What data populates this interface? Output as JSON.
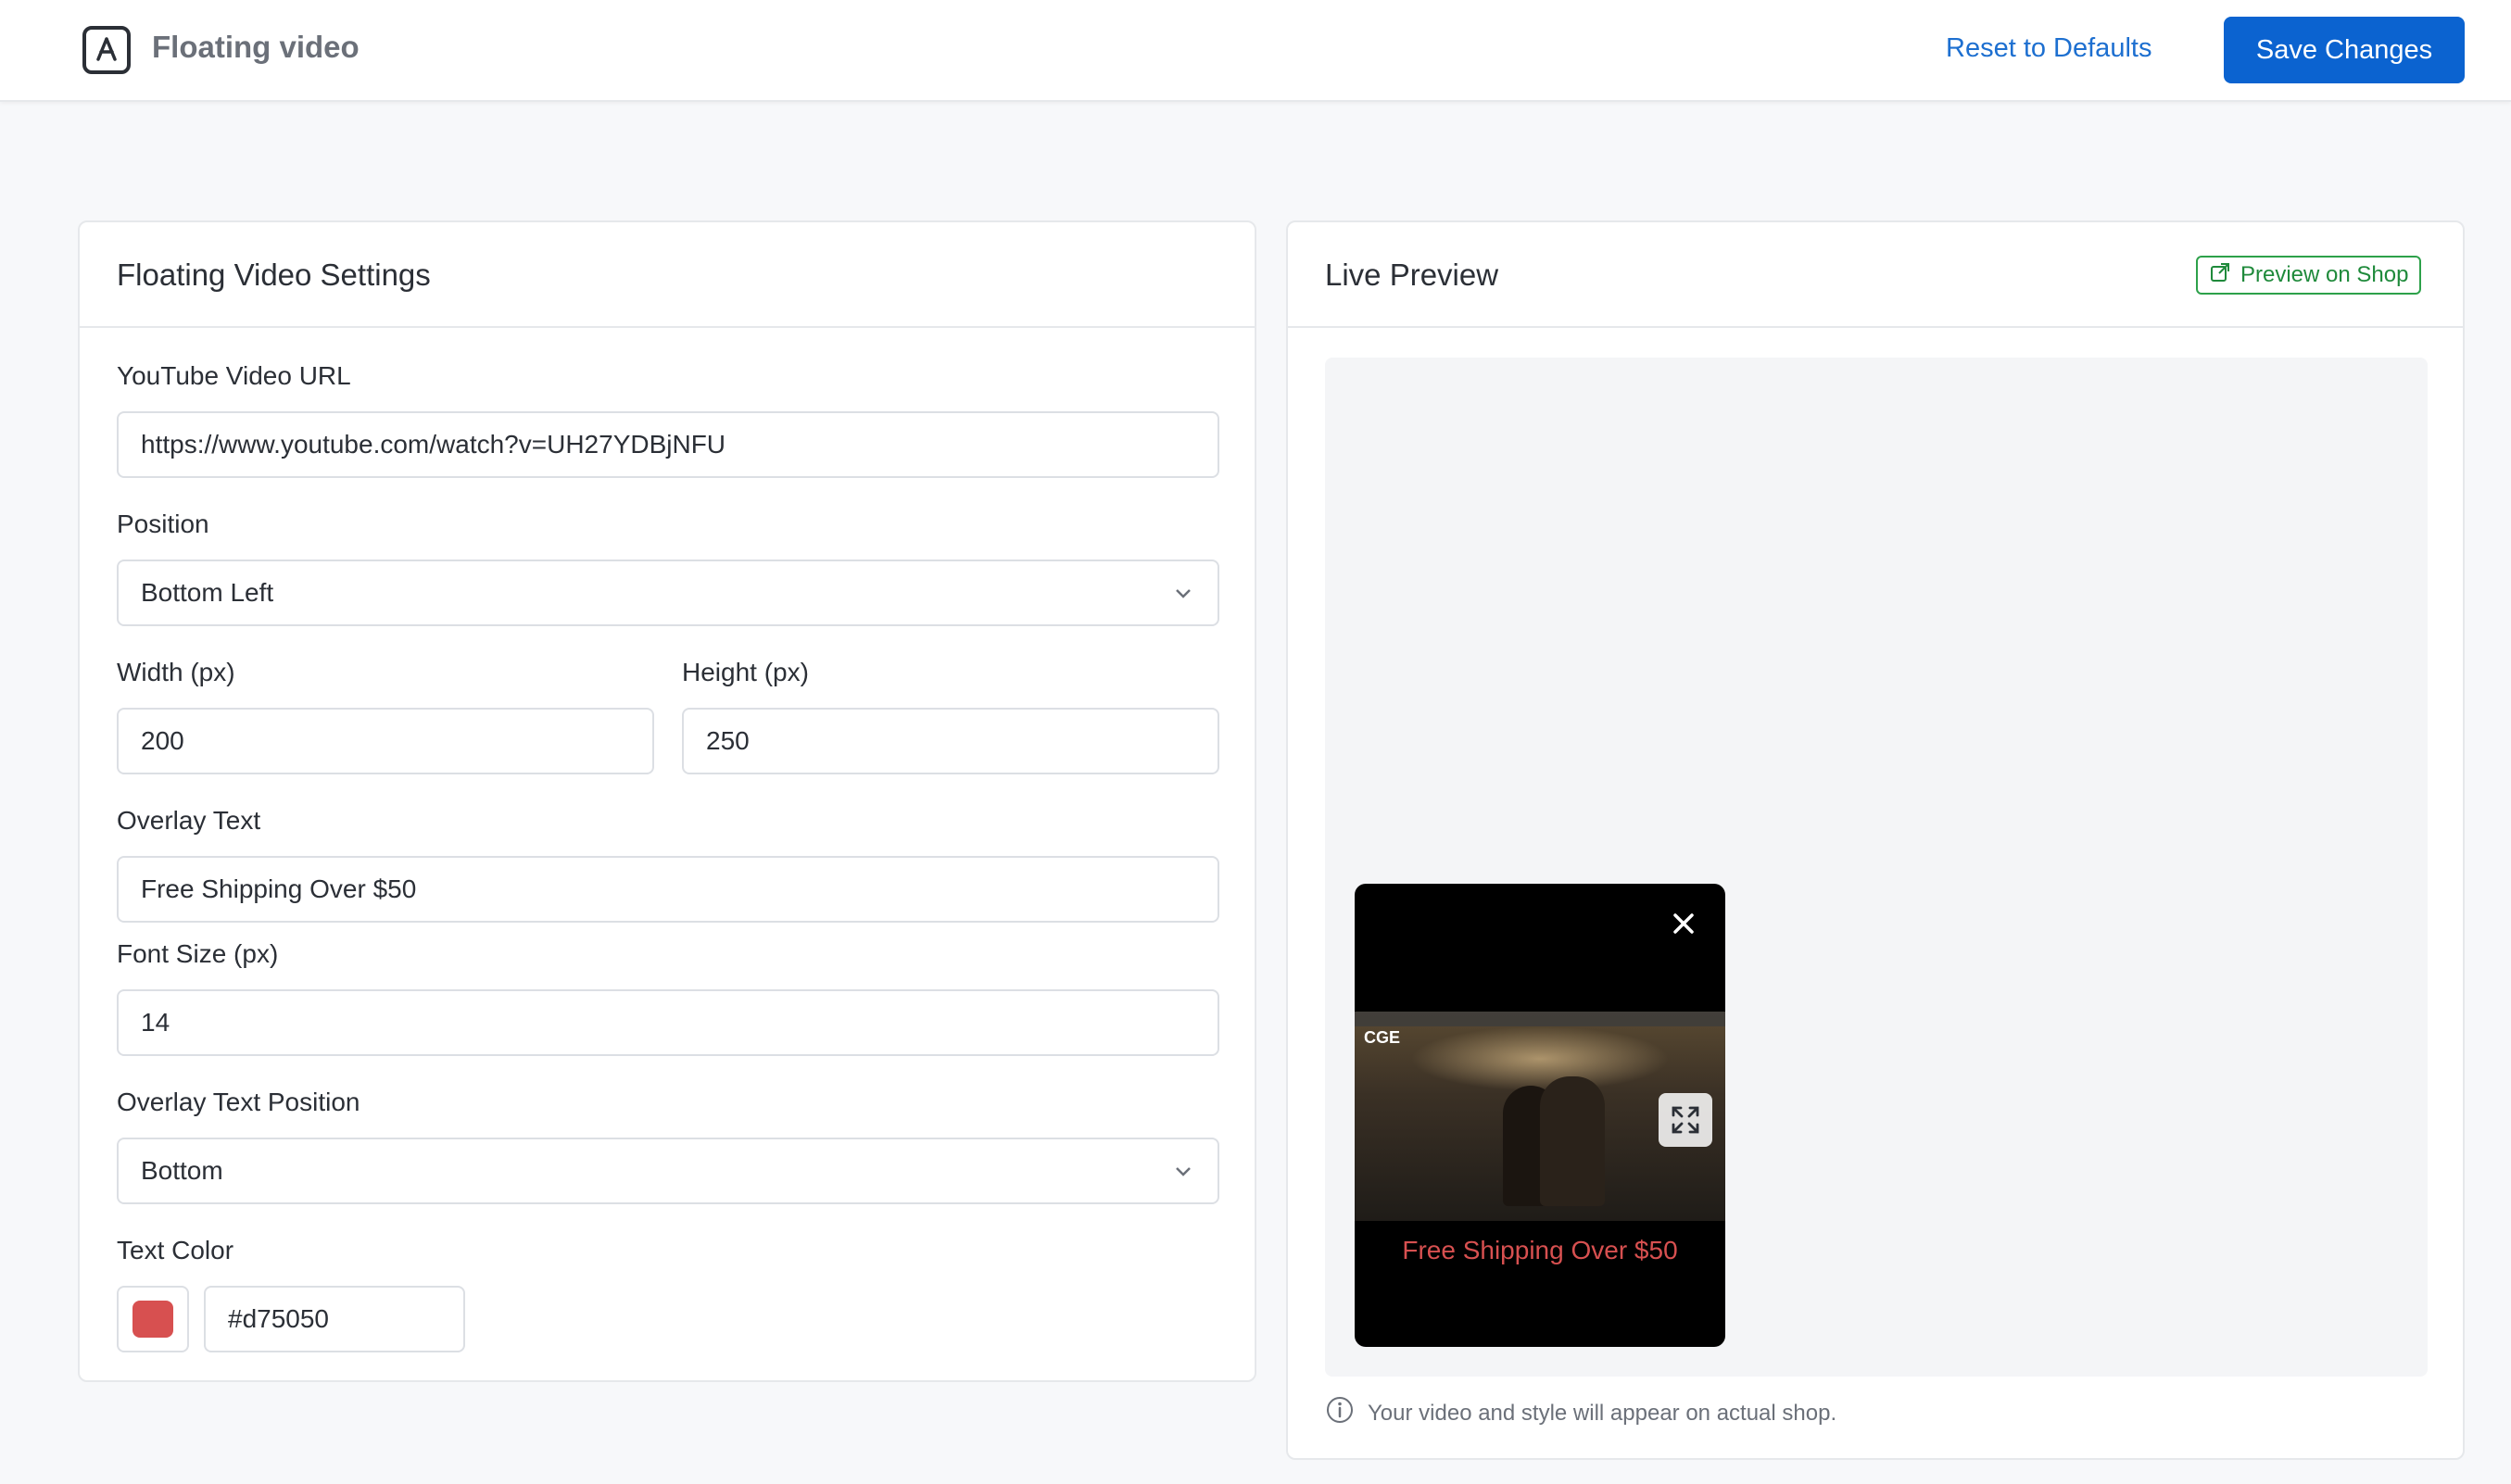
{
  "header": {
    "app_title": "Floating video",
    "reset_label": "Reset to Defaults",
    "save_label": "Save Changes"
  },
  "settings": {
    "title": "Floating Video Settings",
    "youtube_label": "YouTube Video URL",
    "youtube_value": "https://www.youtube.com/watch?v=UH27YDBjNFU",
    "position_label": "Position",
    "position_value": "Bottom Left",
    "width_label": "Width (px)",
    "width_value": "200",
    "height_label": "Height (px)",
    "height_value": "250",
    "overlay_label": "Overlay Text",
    "overlay_value": "Free Shipping Over $50",
    "font_size_label": "Font Size (px)",
    "font_size_value": "14",
    "overlay_position_label": "Overlay Text Position",
    "overlay_position_value": "Bottom",
    "text_color_label": "Text Color",
    "text_color_value": "#d75050"
  },
  "preview": {
    "title": "Live Preview",
    "preview_link_label": "Preview on Shop",
    "overlay_text": "Free Shipping Over $50",
    "video_logo": "CGE",
    "note": "Your video and style will appear on actual shop."
  },
  "colors": {
    "primary": "#0b63d0",
    "link": "#1d6fd0",
    "success": "#2da14a",
    "overlay_text": "#d75050"
  },
  "icons": {
    "app": "app-store-icon",
    "chevron": "chevron-down-icon",
    "external": "external-link-icon",
    "close": "close-icon",
    "expand": "expand-icon",
    "info": "info-icon"
  }
}
